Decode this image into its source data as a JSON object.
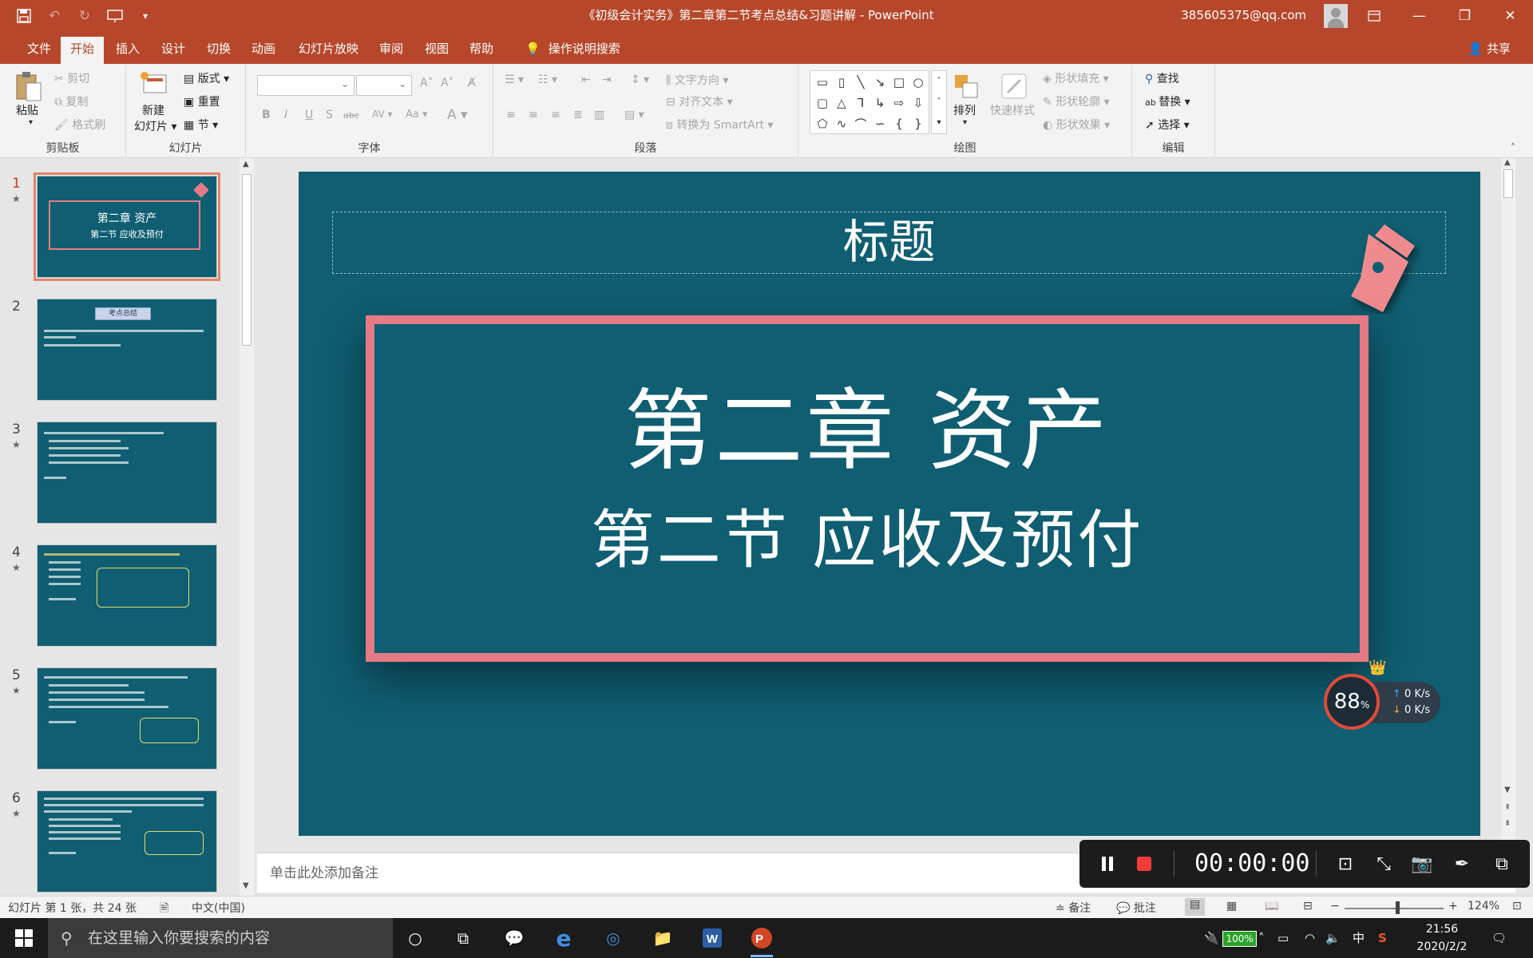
{
  "window": {
    "title": "《初级会计实务》第二章第二节考点总结&习题讲解 - PowerPoint",
    "account": "385605375@qq.com"
  },
  "tabs": [
    "文件",
    "开始",
    "插入",
    "设计",
    "切换",
    "动画",
    "幻灯片放映",
    "审阅",
    "视图",
    "帮助"
  ],
  "tell_me": "操作说明搜索",
  "share": "共享",
  "ribbon": {
    "clipboard": {
      "label": "剪贴板",
      "paste": "粘贴",
      "cut": "剪切",
      "copy": "复制",
      "format_painter": "格式刷"
    },
    "slides": {
      "label": "幻灯片",
      "new_slide_1": "新建",
      "new_slide_2": "幻灯片",
      "layout": "版式",
      "reset": "重置",
      "section": "节"
    },
    "font": {
      "label": "字体"
    },
    "paragraph": {
      "label": "段落",
      "text_direction": "文字方向",
      "align_text": "对齐文本",
      "smartart": "转换为 SmartArt"
    },
    "drawing": {
      "label": "绘图",
      "arrange": "排列",
      "quick_styles": "快速样式",
      "shape_fill": "形状填充",
      "shape_outline": "形状轮廓",
      "shape_effects": "形状效果"
    },
    "editing": {
      "label": "编辑",
      "find": "查找",
      "replace": "替换",
      "select": "选择"
    }
  },
  "thumbnails": [
    {
      "num": "1",
      "star": "★",
      "title": "第二章  资产",
      "subtitle": "第二节  应收及预付"
    },
    {
      "num": "2",
      "star": "",
      "title": "考点总结"
    },
    {
      "num": "3",
      "star": "★"
    },
    {
      "num": "4",
      "star": "★"
    },
    {
      "num": "5",
      "star": "★"
    },
    {
      "num": "6",
      "star": "★"
    }
  ],
  "slide": {
    "title_placeholder": "标题",
    "chapter": "第二章  资产",
    "section": "第二节  应收及预付"
  },
  "notes_placeholder": "单击此处添加备注",
  "recorder": {
    "time": "00:00:00"
  },
  "speed_widget": {
    "percent": "88",
    "unit": "%",
    "up": "0 K/s",
    "down": "0 K/s"
  },
  "status": {
    "slide_info": "幻灯片 第 1 张，共 24 张",
    "language": "中文(中国)",
    "notes": "备注",
    "comments": "批注",
    "zoom": "124%"
  },
  "taskbar": {
    "search_placeholder": "在这里输入你要搜索的内容",
    "battery": "100%",
    "ime": "中",
    "time": "21:56",
    "date": "2020/2/2"
  },
  "colors": {
    "accent": "#b7472a",
    "slide_bg": "#0f5e72",
    "frame": "#e57a85"
  }
}
